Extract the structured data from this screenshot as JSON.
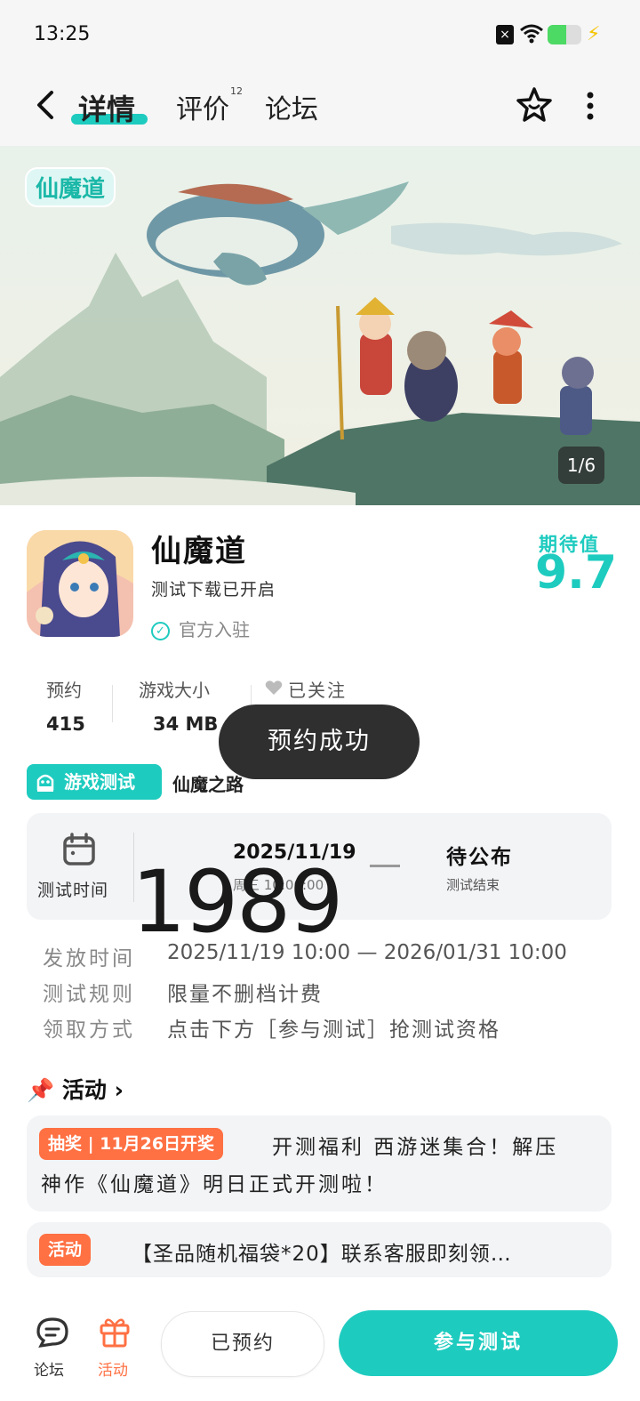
{
  "status_bar": {
    "time": "13:25",
    "battery_level": 0.55
  },
  "nav": {
    "tabs": [
      {
        "label": "详情",
        "active": true
      },
      {
        "label": "评价",
        "count": "12"
      },
      {
        "label": "论坛"
      }
    ],
    "icons": [
      "back-icon",
      "star-icon",
      "more-icon"
    ]
  },
  "banner": {
    "logo_text": "仙魔道",
    "pager": "1/6"
  },
  "app": {
    "title": "仙魔道",
    "subtitle": "测试下载已开启",
    "official": "官方入驻",
    "expect_label": "期待值",
    "expect_value": "9.7"
  },
  "stats": {
    "reserve_label": "预约",
    "reserve_value": "415",
    "size_label": "游戏大小",
    "size_value": "34 MB",
    "follow_label": "已关注"
  },
  "toast": "预约成功",
  "test": {
    "tag": "游戏测试",
    "name": "仙魔之路",
    "time_label": "测试时间",
    "start_date": "2025/11/19",
    "start_time": "周三 10:00:00",
    "end_date": "待公布",
    "end_sub": "测试结束",
    "overlay_number": "1989"
  },
  "info": [
    {
      "key": "发放时间",
      "value": "2025/11/19 10:00 — 2026/01/31 10:00"
    },
    {
      "key": "测试规则",
      "value": "限量不删档计费"
    },
    {
      "key": "领取方式",
      "value": "点击下方［参与测试］抢测试资格"
    }
  ],
  "activities": {
    "title": "活动",
    "items": [
      {
        "badge": "抽奖 | 11月26日开奖",
        "text1": "开测福利 西游迷集合！解压",
        "text2": "神作《仙魔道》明日正式开测啦！"
      },
      {
        "badge": "活动",
        "text1": "【圣品随机福袋*20】联系客服即刻领…"
      }
    ]
  },
  "bottom": {
    "forum_label": "论坛",
    "activity_label": "活动",
    "booked_label": "已预约",
    "join_label": "参与测试"
  },
  "colors": {
    "accent": "#1ecbbf",
    "orange": "#ff7043"
  }
}
